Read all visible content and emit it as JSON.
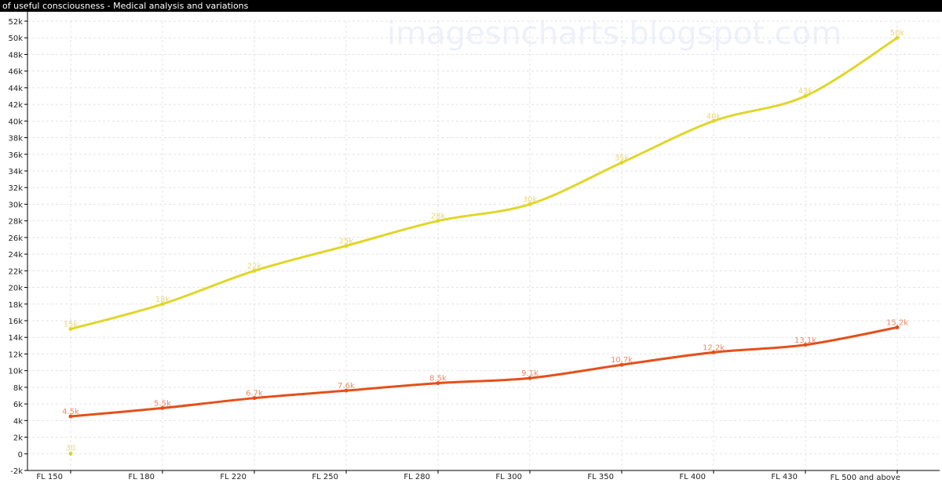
{
  "window": {
    "title": "of useful consciousness - Medical analysis and variations"
  },
  "watermark": "imagesncharts.blogspot.com",
  "colors": {
    "series_yellow": "#e0d62a",
    "series_orange": "#e5501a",
    "label_yellow": "#e8d77a",
    "label_orange": "#ee8a66",
    "extra_point": "#c9d93a",
    "grid": "#e3e3e3",
    "axis": "#000000"
  },
  "chart_data": {
    "type": "line",
    "categories": [
      "FL 150",
      "FL 180",
      "FL 220",
      "FL 250",
      "FL 280",
      "FL 300",
      "FL 350",
      "FL 400",
      "FL 430",
      "FL 500 and above"
    ],
    "series": [
      {
        "values": [
          15000,
          18000,
          22000,
          25000,
          28000,
          30000,
          35000,
          40000,
          43000,
          50000
        ],
        "labels": [
          "15k",
          "18k",
          "22k",
          "25k",
          "28k",
          "30k",
          "35k",
          "40k",
          "43k",
          "50k"
        ],
        "color": "#e0d62a"
      },
      {
        "values": [
          4500,
          5500,
          6700,
          7600,
          8500,
          9100,
          10700,
          12200,
          13100,
          15200
        ],
        "labels": [
          "4.5k",
          "5.5k",
          "6.7k",
          "7.6k",
          "8.5k",
          "9.1k",
          "10.7k",
          "12.2k",
          "13.1k",
          "15.2k"
        ],
        "color": "#e5501a"
      }
    ],
    "extra_point": {
      "category": "FL 150",
      "value": 30,
      "label": "30"
    },
    "ylim": [
      -2000,
      52000
    ],
    "ytick_step": 2000,
    "ytick_labels": [
      "-2k",
      "0",
      "2k",
      "4k",
      "6k",
      "8k",
      "10k",
      "12k",
      "14k",
      "16k",
      "18k",
      "20k",
      "22k",
      "24k",
      "26k",
      "28k",
      "30k",
      "32k",
      "34k",
      "36k",
      "38k",
      "40k",
      "42k",
      "44k",
      "46k",
      "48k",
      "50k",
      "52k"
    ],
    "grid": true,
    "smooth": true,
    "title": "",
    "xlabel": "",
    "ylabel": ""
  }
}
